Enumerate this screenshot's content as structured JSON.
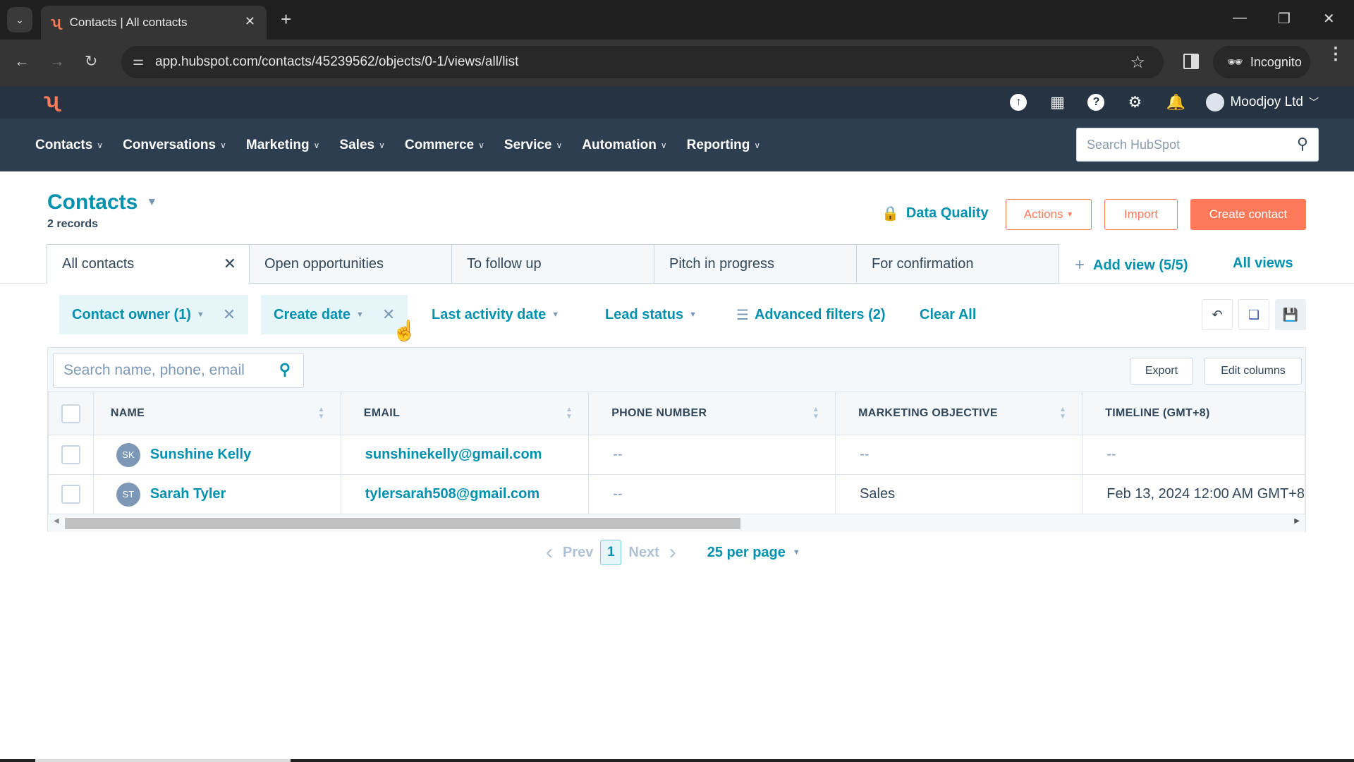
{
  "browser": {
    "tab_title": "Contacts | All contacts",
    "url": "app.hubspot.com/contacts/45239562/objects/0-1/views/all/list",
    "incognito_label": "Incognito"
  },
  "topbar": {
    "account_name": "Moodjoy Ltd",
    "icons": [
      "upgrade-icon",
      "marketplace-icon",
      "help-icon",
      "settings-icon",
      "notifications-icon"
    ]
  },
  "nav": {
    "items": [
      "Contacts",
      "Conversations",
      "Marketing",
      "Sales",
      "Commerce",
      "Service",
      "Automation",
      "Reporting"
    ],
    "search_placeholder": "Search HubSpot"
  },
  "header": {
    "title": "Contacts",
    "record_count": "2 records",
    "data_quality": "Data Quality",
    "actions": "Actions",
    "import": "Import",
    "create": "Create contact"
  },
  "views": {
    "tabs": [
      "All contacts",
      "Open opportunities",
      "To follow up",
      "Pitch in progress",
      "For confirmation"
    ],
    "add_view": "Add view (5/5)",
    "all_views": "All views"
  },
  "filters": {
    "contact_owner": "Contact owner (1)",
    "create_date": "Create date",
    "last_activity": "Last activity date",
    "lead_status": "Lead status",
    "advanced": "Advanced filters (2)",
    "clear_all": "Clear All"
  },
  "table": {
    "search_placeholder": "Search name, phone, email",
    "export": "Export",
    "edit_columns": "Edit columns",
    "columns": [
      "NAME",
      "EMAIL",
      "PHONE NUMBER",
      "MARKETING OBJECTIVE",
      "TIMELINE (GMT+8)"
    ],
    "rows": [
      {
        "initials": "SK",
        "name": "Sunshine Kelly",
        "email": "sunshinekelly@gmail.com",
        "phone": "--",
        "objective": "--",
        "timeline": "--"
      },
      {
        "initials": "ST",
        "name": "Sarah Tyler",
        "email": "tylersarah508@gmail.com",
        "phone": "--",
        "objective": "Sales",
        "timeline": "Feb 13, 2024 12:00 AM GMT+8"
      }
    ]
  },
  "pagination": {
    "prev": "Prev",
    "page": "1",
    "next": "Next",
    "per_page": "25 per page"
  }
}
